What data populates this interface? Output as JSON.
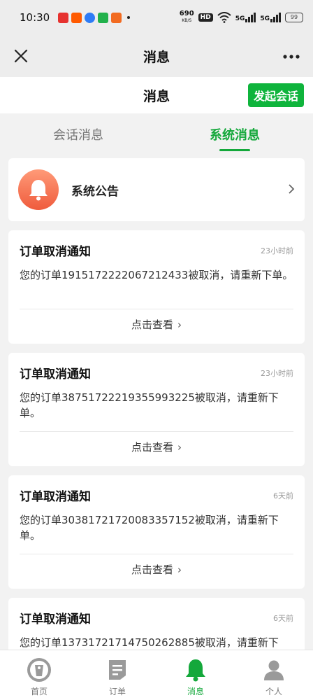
{
  "status_bar": {
    "time": "10:30",
    "net_speed": "690",
    "net_unit": "KB/S",
    "hd": "HD",
    "signal1": "5G",
    "signal2": "5G",
    "battery": "99",
    "app_colors": [
      "#e6322f",
      "#ff5a00",
      "#2e7cf6",
      "#22b14c",
      "#f26b21"
    ]
  },
  "top_nav": {
    "close_icon": "close-icon",
    "title": "消息",
    "more_icon": "more-icon"
  },
  "page_header": {
    "title": "消息",
    "start_chat_label": "发起会话"
  },
  "tabs": [
    {
      "label": "会话消息",
      "active": false
    },
    {
      "label": "系统消息",
      "active": true
    }
  ],
  "announcement": {
    "label": "系统公告",
    "icon": "bell-icon"
  },
  "notices": [
    {
      "title": "订单取消通知",
      "time": "23小时前",
      "body": "您的订单1915172222067212433被取消，请重新下单。",
      "link": "点击查看"
    },
    {
      "title": "订单取消通知",
      "time": "23小时前",
      "body": "您的订单3875172221935599322​5被取消，请重新下单。",
      "link": "点击查看"
    },
    {
      "title": "订单取消通知",
      "time": "6天前",
      "body": "您的订单3038172172008335715​2被取消，请重新下单。",
      "link": "点击查看"
    },
    {
      "title": "订单取消通知",
      "time": "6天前",
      "body": "您的订单1373172171475026288​5被取消，请重新下",
      "link": ""
    }
  ],
  "bottom_nav": [
    {
      "label": "首页",
      "icon": "home-icon",
      "active": false
    },
    {
      "label": "订单",
      "icon": "order-icon",
      "active": false
    },
    {
      "label": "消息",
      "icon": "bell-icon",
      "active": true
    },
    {
      "label": "个人",
      "icon": "person-icon",
      "active": false
    }
  ],
  "colors": {
    "accent": "#14a83b",
    "button": "#0fb43c",
    "bell_gradient_top": "#ff9a78",
    "bell_gradient_bottom": "#ef5b3c"
  }
}
